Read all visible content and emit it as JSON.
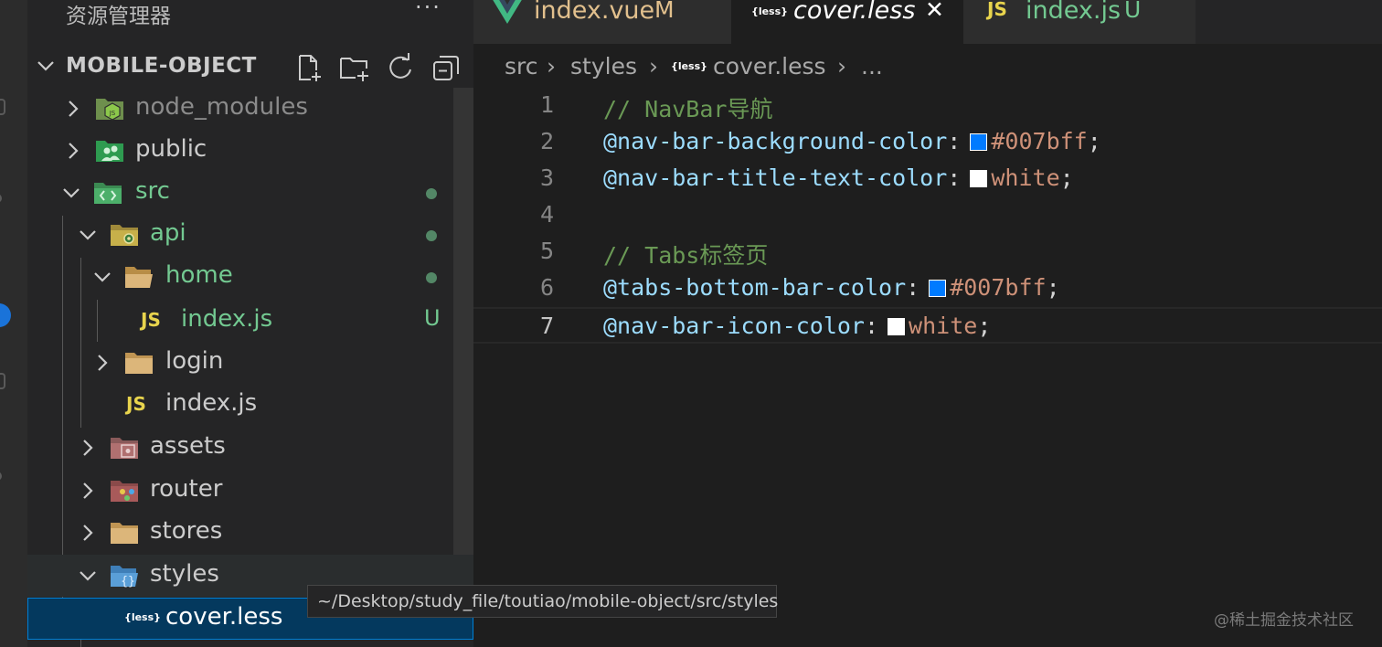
{
  "explorer": {
    "title": "资源管理器",
    "more": "···",
    "project": "MOBILE-OBJECT"
  },
  "tree": [
    {
      "label": "node_modules",
      "icon": "nodejs-folder-icon",
      "color": "#8b8b8b"
    },
    {
      "label": "public",
      "icon": "public-folder-icon",
      "color": "#cccccc"
    },
    {
      "label": "src",
      "icon": "src-folder-icon",
      "color": "#73c991"
    },
    {
      "label": "api",
      "icon": "api-folder-icon",
      "color": "#73c991"
    },
    {
      "label": "home",
      "icon": "folder-open-icon",
      "color": "#73c991"
    },
    {
      "label": "index.js",
      "icon": "js-file-icon",
      "color": "#73c991",
      "status": "U"
    },
    {
      "label": "login",
      "icon": "folder-icon",
      "color": "#cccccc"
    },
    {
      "label": "index.js",
      "icon": "js-file-icon",
      "color": "#cccccc"
    },
    {
      "label": "assets",
      "icon": "assets-folder-icon",
      "color": "#cccccc"
    },
    {
      "label": "router",
      "icon": "router-folder-icon",
      "color": "#cccccc"
    },
    {
      "label": "stores",
      "icon": "folder-icon",
      "color": "#cccccc"
    },
    {
      "label": "styles",
      "icon": "styles-folder-icon",
      "color": "#cccccc"
    },
    {
      "label": "cover.less",
      "icon": "less-file-icon",
      "color": "#ffffff"
    }
  ],
  "tooltip": "~/Desktop/study_file/toutiao/mobile-object/src/styles",
  "tabs": [
    {
      "label": "index.vue",
      "status": "M"
    },
    {
      "label": "cover.less",
      "close": "✕"
    },
    {
      "label": "index.js",
      "status": "U"
    }
  ],
  "breadcrumb": {
    "parts": [
      "src",
      "styles",
      "cover.less",
      "..."
    ],
    "sep": "›"
  },
  "less_badge": "{less}",
  "js_badge": "JS",
  "code": {
    "lines": [
      {
        "n": "1",
        "comment": "// NavBar导航"
      },
      {
        "n": "2",
        "var": "@nav-bar-background-color",
        "colon": ":",
        "swatch": "#007bff",
        "value": "#007bff",
        "semi": ";"
      },
      {
        "n": "3",
        "var": "@nav-bar-title-text-color",
        "colon": ":",
        "swatch": "#ffffff",
        "value": "white",
        "semi": ";"
      },
      {
        "n": "4"
      },
      {
        "n": "5",
        "comment": "// Tabs标签页"
      },
      {
        "n": "6",
        "var": "@tabs-bottom-bar-color",
        "colon": ":",
        "swatch": "#007bff",
        "value": "#007bff",
        "semi": ";"
      },
      {
        "n": "7",
        "var": "@nav-bar-icon-color",
        "colon": ":",
        "swatch": "#ffffff",
        "value": "white",
        "semi": ";"
      }
    ]
  },
  "watermark": "@稀土掘金技术社区"
}
